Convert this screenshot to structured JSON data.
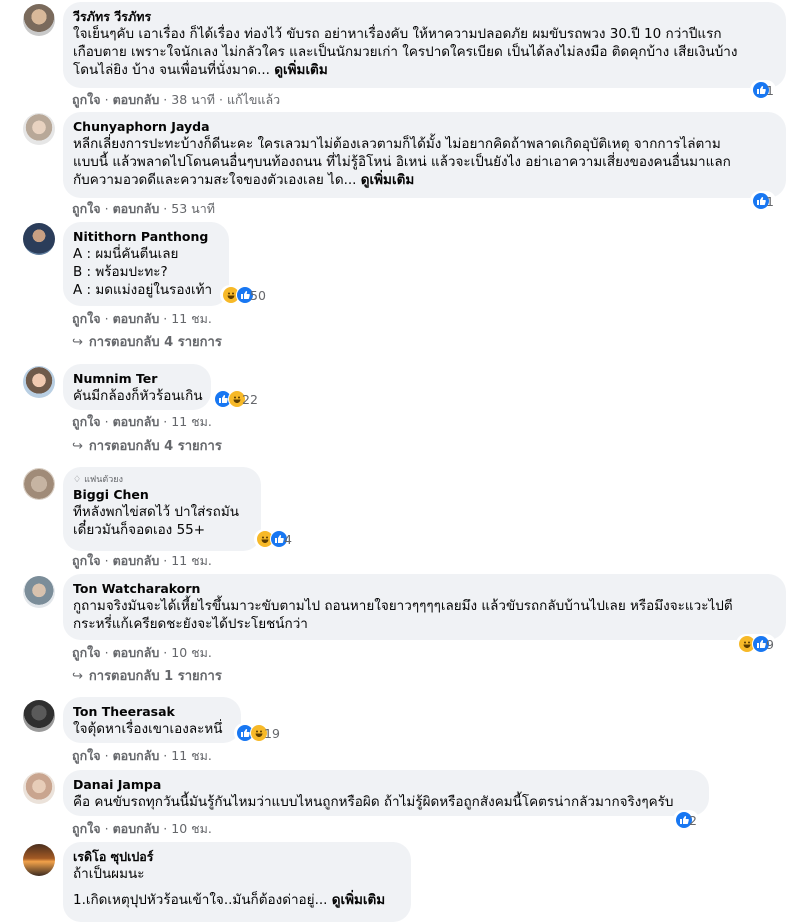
{
  "labels": {
    "like": "ถูกใจ",
    "reply": "ตอบกลับ",
    "dot": "·"
  },
  "comments": [
    {
      "name": "วีรภัทร วีรภัทร",
      "lines": [
        "ใจเย็นๆคับ เอาเรื่อง ก็ได้เรื่อง ท่องไว้ ขับรถ อย่าหาเรื่องคับ ให้หาความปลอดภัย ผมขับรถพวง 30.ปี 10 กว่าปีแรก",
        "เกือบตาย เพราะใจนักเลง ไม่กลัวใคร และเป็นนักมวยเก่า ใครปาดใครเบียด เป็นได้ลงไม่ลงมือ ติดคุกบ้าง เสียเงินบ้าง",
        "โดนไล่ยิง บ้าง จนเพื่อนที่นั่งมาด..."
      ],
      "see_more": "ดูเพิ่มเติม",
      "time": "38 นาที",
      "edited": "แก้ไขแล้ว",
      "reaction_count": "1"
    },
    {
      "name": "Chunyaphorn Jayda",
      "lines": [
        "หลีกเลี่ยงการปะทะบ้างก็ดีนะคะ ใครเลวมาไม่ต้องเลวตามก็ได้มั้ง ไม่อยากคิดถ้าพลาดเกิดอุบัติเหตุ จากการไล่ตาม",
        "แบบนี้ แล้วพลาดไปโดนคนอื่นๆบนท้องถนน ที่ไม่รู้อิโหน่ อิเหน่ แล้วจะเป็นยังไง อย่าเอาความเสี่ยงของคนอื่นมาแลก",
        "กับความอวดดีและความสะใจของตัวเองเลย ได..."
      ],
      "see_more": "ดูเพิ่มเติม",
      "time": "53 นาที",
      "reaction_count": "1"
    },
    {
      "name": "Nitithorn Panthong",
      "lines": [
        "A : ผมนี่คันตีนเลย",
        "B : พร้อมปะทะ?",
        "A : มดแม่งอยู่ในรองเท้า"
      ],
      "time": "11 ชม.",
      "reaction_count": "50",
      "replies": "การตอบกลับ 4 รายการ"
    },
    {
      "name": "Numnim Ter",
      "lines": [
        "คันมีกล้องก็หัวร้อนเกิน"
      ],
      "time": "11 ชม.",
      "reaction_count": "22",
      "replies": "การตอบกลับ 4 รายการ"
    },
    {
      "fan_badge": "แฟนตัวยง",
      "name": "Biggi Chen",
      "lines": [
        "ทีหลังพกไข่สดไว้ ปาใส่รถมัน",
        "เดี๋ยวมันก็จอดเอง 55+"
      ],
      "time": "11 ชม.",
      "reaction_count": "4"
    },
    {
      "name": "Ton Watcharakorn",
      "lines": [
        "กูถามจริงมันจะได้เหี้ยไรขึ้นมาวะขับตามไป ถอนหายใจยาวๆๆๆๆเลยมึง แล้วขับรถกลับบ้านไปเลย หรือมึงจะแวะไปตี",
        "กระหรี่แก้เครียดชะยังจะได้ประโยชน์กว่า"
      ],
      "time": "10 ชม.",
      "reaction_count": "9",
      "replies": "การตอบกลับ 1 รายการ"
    },
    {
      "name": "Ton Theerasak",
      "lines": [
        "ใจตุ้ดหาเรื่องเขาเองละหนึ่"
      ],
      "time": "11 ชม.",
      "reaction_count": "19"
    },
    {
      "name": "Danai Jampa",
      "lines": [
        "คือ คนขับรถทุกวันนี้มันรู้กันไหมว่าแบบไหนถูกหรือผิด ถ้าไม่รู้ผิดหรือถูกสังคมนี้โคตรน่ากลัวมากจริงๆครับ"
      ],
      "time": "10 ชม.",
      "reaction_count": "2"
    },
    {
      "name": "เรดิโอ ซุปเปอร์",
      "lines": [
        "ถ้าเป็นผมนะ",
        "",
        "1.เกิดเหตุปุปหัวร้อนเข้าใจ..มันก็ต้องด่าอยู่..."
      ],
      "see_more": "ดูเพิ่มเติม"
    }
  ],
  "colors": {
    "bubble": "#f0f2f5",
    "like": "#1877f2",
    "haha": "#f7b928",
    "meta": "#65676b"
  }
}
